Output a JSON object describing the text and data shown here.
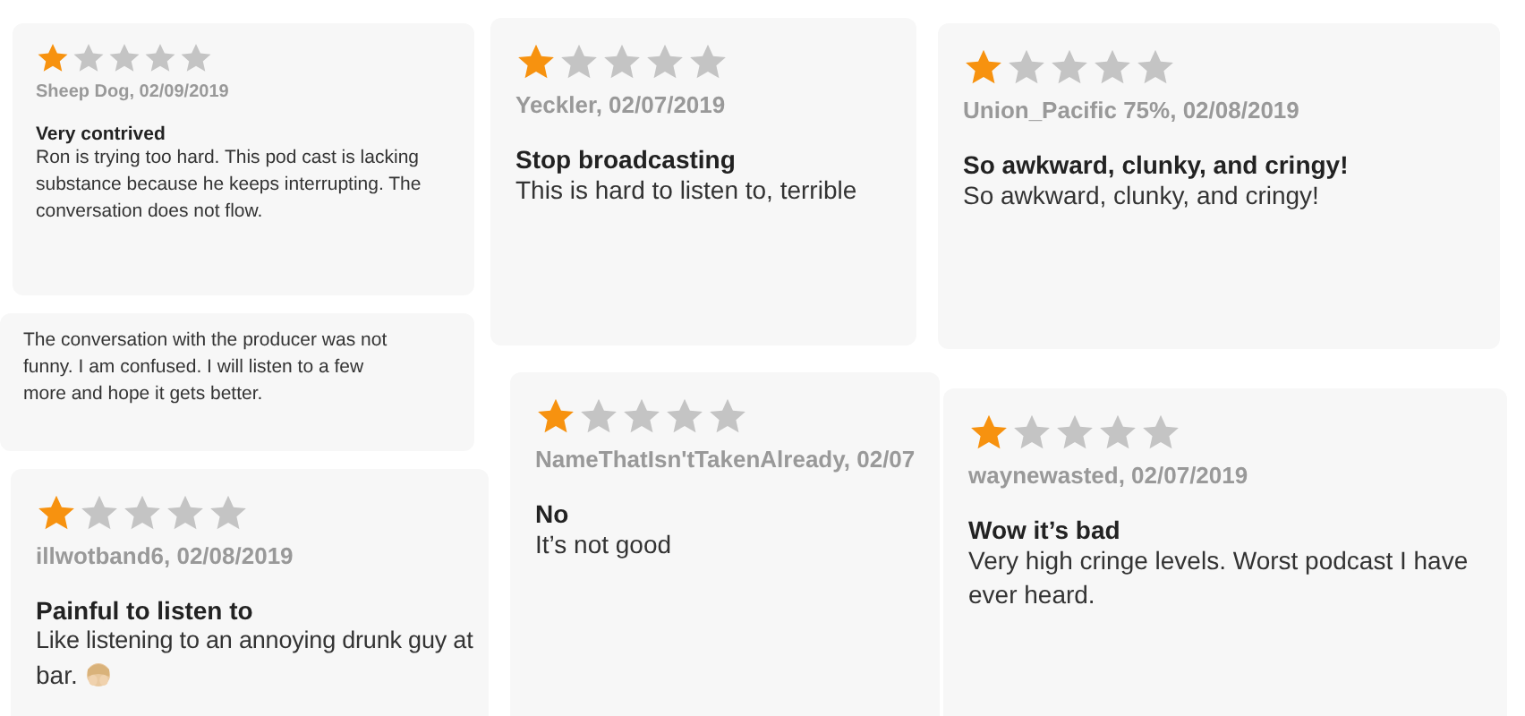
{
  "cards": [
    {
      "kind": "review",
      "stars": 1,
      "author": "Sheep Dog, 02/09/2019",
      "title": "Very contrived",
      "body": "Ron is trying too hard. This pod cast is lacking substance because he keeps interrupting. The conversation does not flow."
    },
    {
      "kind": "fragment",
      "body": "The conversation with the producer was not funny. I am confused. I will listen to a few more and hope it gets better."
    },
    {
      "kind": "review",
      "stars": 1,
      "author": "Yeckler, 02/07/2019",
      "title": "Stop broadcasting",
      "body": "This is hard to listen to, terrible"
    },
    {
      "kind": "review",
      "stars": 1,
      "author": "Union_Pacific 75%, 02/08/2019",
      "title": "So awkward, clunky, and cringy!",
      "body": "So awkward, clunky, and cringy!"
    },
    {
      "kind": "review",
      "stars": 1,
      "author": "illwotband6, 02/08/2019",
      "title": "Painful to listen to",
      "body": "Like listening to an annoying drunk guy at",
      "body_end": "bar.",
      "emoji": true
    },
    {
      "kind": "review",
      "stars": 1,
      "author": "NameThatIsn'tTakenAlready, 02/07",
      "title": "No",
      "body": "It’s not good"
    },
    {
      "kind": "review",
      "stars": 1,
      "author": "waynewasted, 02/07/2019",
      "title": "Wow it’s bad",
      "body": "Very high cringe levels. Worst podcast I have ever heard."
    }
  ]
}
